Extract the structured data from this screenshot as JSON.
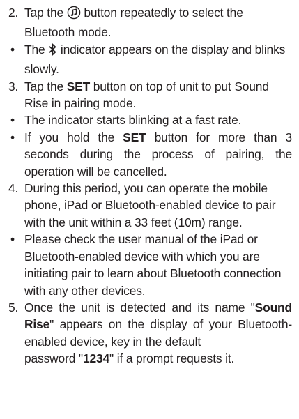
{
  "steps": {
    "s2": {
      "num": "2.",
      "pre": "Tap the",
      "post": "button repeatedly to select the Bluetooth mode."
    },
    "b1": {
      "pre": "The",
      "post": "indicator appears on the display and blinks slowly."
    },
    "s3": {
      "num": "3.",
      "pre": "Tap the",
      "bold": "SET",
      "post": "button on top of unit to put Sound Rise in pairing mode."
    },
    "b2": {
      "text": "The indicator starts blinking at a fast rate."
    },
    "b3": {
      "pre": "If you hold the",
      "bold": "SET",
      "post": "button for more than 3 seconds during the process of pairing, the operation will be cancelled."
    },
    "s4": {
      "num": "4.",
      "text": "During this period, you can operate the mobile phone, iPad or Bluetooth-enabled device to pair with the unit within a 33 feet (10m) range."
    },
    "b4": {
      "text": "Please check the user manual of the iPad or Bluetooth-enabled device with which you are initiating pair to learn about Bluetooth connection with any other devices."
    },
    "s5": {
      "num": "5.",
      "pre": "Once the unit is detected and its name \"",
      "bold1": "Sound Rise",
      "mid": "\" appears on the display of your Bluetooth-enabled device, key in the default",
      "last_pre": "password \"",
      "bold2": "1234",
      "last_post": "\" if a prompt requests it."
    }
  },
  "bullet_char": "•",
  "icons": {
    "mode": "music-note-circle-icon",
    "bluetooth": "bluetooth-icon"
  }
}
